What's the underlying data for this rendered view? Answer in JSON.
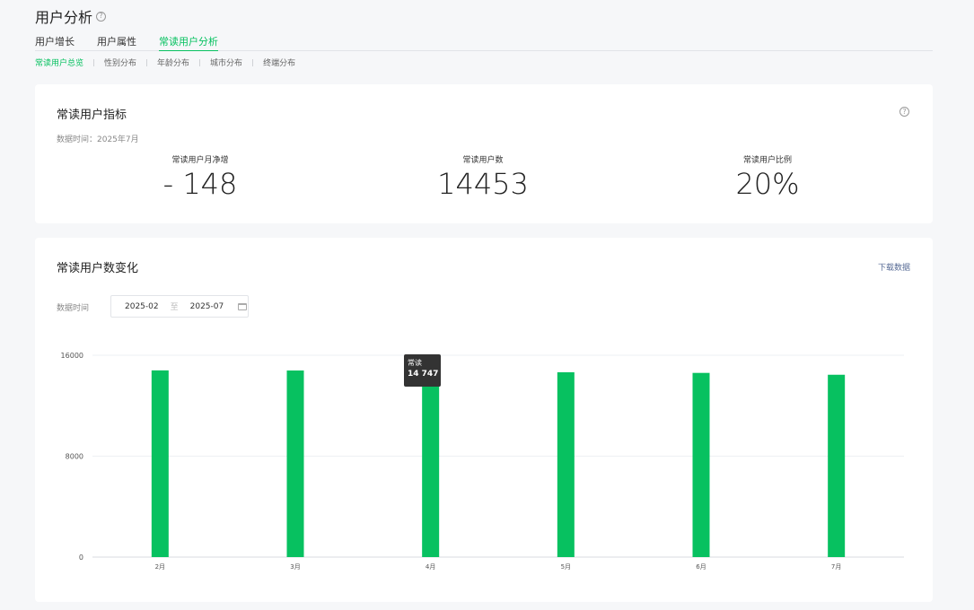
{
  "header": {
    "title": "用户分析",
    "help": "?"
  },
  "tabs": [
    {
      "label": "用户增长",
      "active": false
    },
    {
      "label": "用户属性",
      "active": false
    },
    {
      "label": "常读用户分析",
      "active": true
    }
  ],
  "subtabs": [
    {
      "label": "常读用户总览",
      "active": true
    },
    {
      "label": "性别分布",
      "active": false
    },
    {
      "label": "年龄分布",
      "active": false
    },
    {
      "label": "城市分布",
      "active": false
    },
    {
      "label": "终端分布",
      "active": false
    }
  ],
  "indicators": {
    "title": "常读用户指标",
    "help": "?",
    "data_time": "数据时间：2025年7月",
    "metrics": [
      {
        "label": "常读用户月净增",
        "value": "- 148"
      },
      {
        "label": "常读用户数",
        "value": "14453"
      },
      {
        "label": "常读用户比例",
        "value": "20%"
      }
    ]
  },
  "trend": {
    "title": "常读用户数变化",
    "download": "下载数据",
    "range_label": "数据时间",
    "range_start": "2025-02",
    "range_sep": "至",
    "range_end": "2025-07",
    "tooltip": {
      "name": "常读",
      "value": "14 747"
    }
  },
  "colors": {
    "accent": "#07c160",
    "link": "#576b95",
    "tooltip_bg": "#333333"
  },
  "chart_data": {
    "type": "bar",
    "categories": [
      "2月",
      "3月",
      "4月",
      "5月",
      "6月",
      "7月"
    ],
    "series": [
      {
        "name": "常读",
        "values": [
          14800,
          14790,
          14747,
          14650,
          14600,
          14453
        ]
      }
    ],
    "ylim": [
      0,
      16000
    ],
    "yticks": [
      0,
      8000,
      16000
    ],
    "grid": true
  }
}
